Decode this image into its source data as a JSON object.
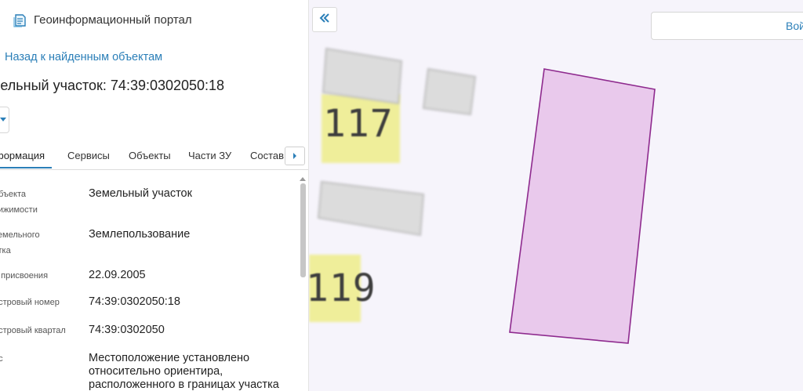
{
  "header": {
    "app_title": "Геоинформационный портал",
    "logo_icon": "layers-icon"
  },
  "nav": {
    "back_label": "Назад к найденным объектам"
  },
  "object": {
    "title": "мельный участок: 74:39:0302050:18"
  },
  "tabs": [
    {
      "label": "формация",
      "active": true
    },
    {
      "label": "Сервисы",
      "active": false
    },
    {
      "label": "Объекты",
      "active": false
    },
    {
      "label": "Части ЗУ",
      "active": false
    },
    {
      "label": "Состав",
      "active": false
    }
  ],
  "properties": [
    {
      "label": [
        "объекта",
        "вижимости"
      ],
      "value": "Земельный участок"
    },
    {
      "label": [
        "земельного",
        "стка"
      ],
      "value": "Землепользование"
    },
    {
      "label": [
        "а присвоения"
      ],
      "value": "22.09.2005"
    },
    {
      "label": [
        "астровый номер"
      ],
      "value": "74:39:0302050:18"
    },
    {
      "label": [
        "астровый квартал"
      ],
      "value": "74:39:0302050"
    },
    {
      "label": [
        "ес"
      ],
      "value": "Местоположение установлено относительно ориентира, расположенного в границах участка"
    }
  ],
  "map": {
    "login_label": "Вой",
    "house_numbers": [
      "117",
      "119"
    ],
    "parcel_fill": "#e9c9ec",
    "parcel_stroke": "#8e2a8e",
    "building_fill": "#dcdcdc",
    "label_bg": "#efee9a"
  },
  "colors": {
    "accent": "#2b7fb8"
  }
}
